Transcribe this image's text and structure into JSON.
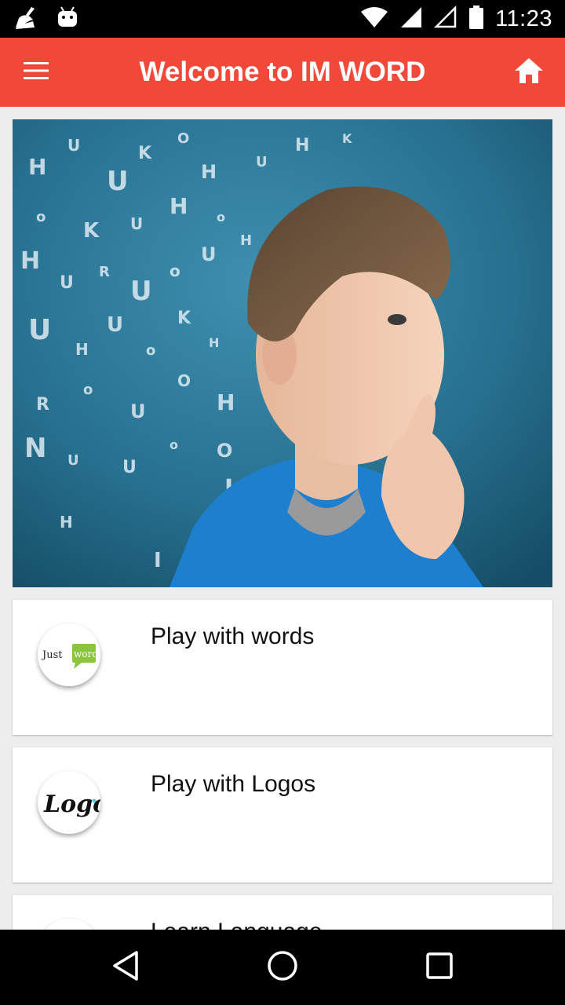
{
  "status_bar": {
    "time": "11:23",
    "left_icons": [
      "cleaner-broom-icon",
      "android-robot-icon"
    ],
    "right_icons": [
      "wifi-icon",
      "signal-full-icon",
      "signal-empty-icon",
      "battery-icon"
    ]
  },
  "app_bar": {
    "title": "Welcome to IM WORD",
    "background_color": "#F0493A",
    "menu_icon": "hamburger-menu-icon",
    "home_icon": "home-icon"
  },
  "hero": {
    "image": "boy-thinking-with-letters"
  },
  "cards": [
    {
      "label": "Play with words",
      "icon_text_1": "Just",
      "icon_text_2": "words",
      "icon": "just-words-logo"
    },
    {
      "label": "Play with Logos",
      "icon_text": "Logo",
      "icon": "logo-script-icon"
    },
    {
      "label": "Learn Language",
      "icon": "language-icon"
    }
  ],
  "nav_bar": {
    "buttons": [
      "back-triangle-icon",
      "home-circle-icon",
      "recents-square-icon"
    ]
  }
}
